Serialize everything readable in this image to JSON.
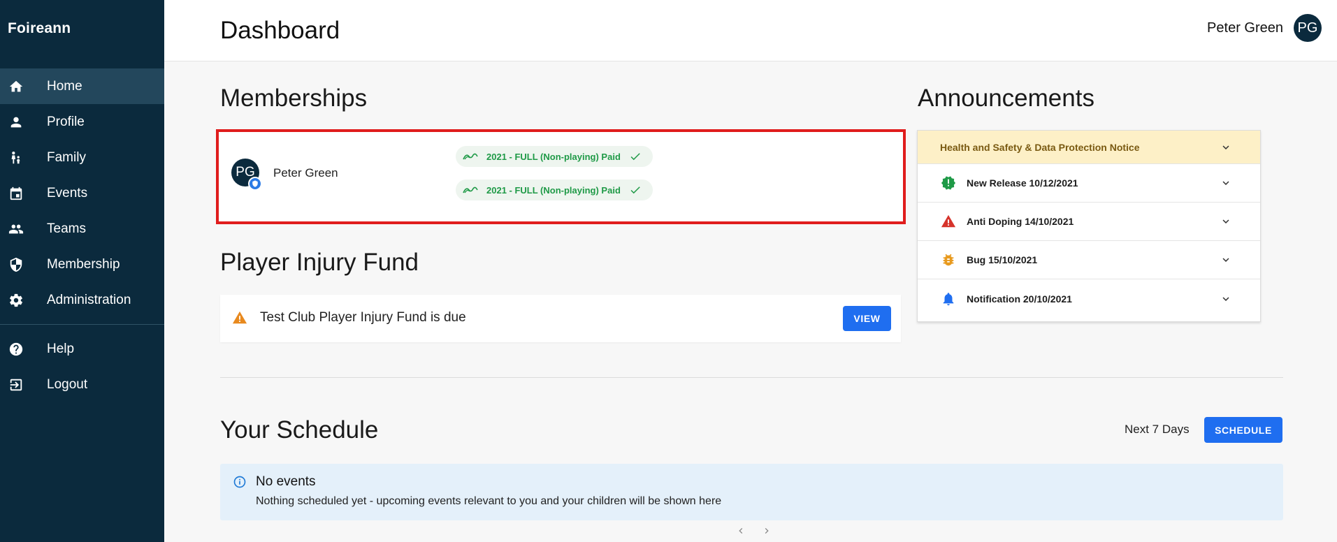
{
  "app": {
    "brand": "Foireann"
  },
  "sidebar": {
    "items": [
      {
        "label": "Home",
        "icon": "home-icon",
        "active": true
      },
      {
        "label": "Profile",
        "icon": "person-icon"
      },
      {
        "label": "Family",
        "icon": "family-icon"
      },
      {
        "label": "Events",
        "icon": "calendar-icon"
      },
      {
        "label": "Teams",
        "icon": "people-icon"
      },
      {
        "label": "Membership",
        "icon": "shield-icon"
      },
      {
        "label": "Administration",
        "icon": "gear-icon"
      }
    ],
    "bottom_items": [
      {
        "label": "Help",
        "icon": "help-icon"
      },
      {
        "label": "Logout",
        "icon": "logout-icon"
      }
    ]
  },
  "header": {
    "title": "Dashboard",
    "user_name": "Peter Green",
    "user_initials": "PG"
  },
  "memberships": {
    "title": "Memberships",
    "member_name": "Peter Green",
    "member_initials": "PG",
    "chips": [
      {
        "label": "2021 - FULL (Non-playing) Paid"
      },
      {
        "label": "2021 - FULL (Non-playing) Paid"
      }
    ],
    "highlight_color": "#e01d1d"
  },
  "injury_fund": {
    "title": "Player Injury Fund",
    "message": "Test Club Player Injury Fund is due",
    "button": "VIEW"
  },
  "announcements": {
    "title": "Announcements",
    "items": [
      {
        "label": "Health and Safety & Data Protection Notice",
        "icon": "",
        "highlight": true
      },
      {
        "label": "New Release 10/12/2021",
        "icon": "new-release-icon"
      },
      {
        "label": "Anti Doping 14/10/2021",
        "icon": "warning-icon"
      },
      {
        "label": "Bug 15/10/2021",
        "icon": "bug-icon"
      },
      {
        "label": "Notification 20/10/2021",
        "icon": "bell-icon"
      }
    ]
  },
  "schedule": {
    "title": "Your Schedule",
    "range": "Next 7 Days",
    "button": "SCHEDULE",
    "empty_title": "No events",
    "empty_text": "Nothing scheduled yet - upcoming events relevant to you and your children will be shown here"
  },
  "colors": {
    "sidebar": "#0b2a3d",
    "primary": "#1f6ef0",
    "success": "#1f9a47"
  }
}
